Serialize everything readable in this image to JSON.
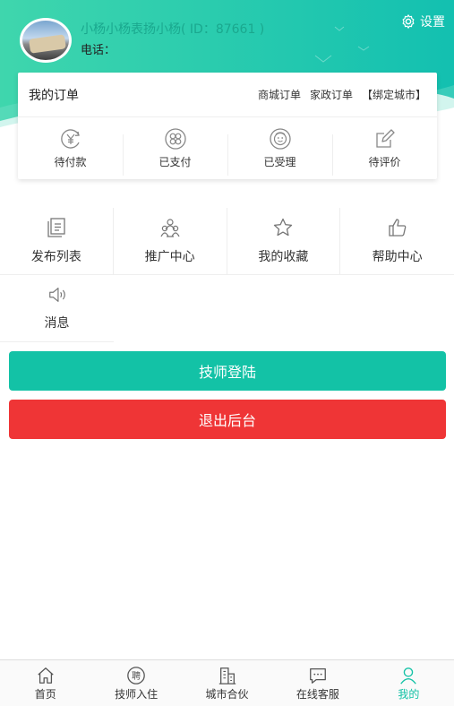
{
  "header": {
    "user_name": "小杨小杨表扬小杨( ID：87661 )",
    "phone_label": "电话：",
    "settings_label": "设置"
  },
  "orders": {
    "title": "我的订单",
    "links": [
      "商城订单",
      "家政订单",
      "【绑定城市】"
    ],
    "states": [
      {
        "label": "待付款",
        "icon": "yuan-refresh-icon"
      },
      {
        "label": "已支付",
        "icon": "paid-icon"
      },
      {
        "label": "已受理",
        "icon": "accepted-icon"
      },
      {
        "label": "待评价",
        "icon": "edit-review-icon"
      }
    ]
  },
  "grid": {
    "items": [
      {
        "label": "发布列表",
        "icon": "list-icon"
      },
      {
        "label": "推广中心",
        "icon": "people-icon"
      },
      {
        "label": "我的收藏",
        "icon": "star-icon"
      },
      {
        "label": "帮助中心",
        "icon": "thumbs-up-icon"
      },
      {
        "label": "消息",
        "icon": "speaker-icon"
      }
    ]
  },
  "buttons": {
    "technician_login": "技师登陆",
    "logout": "退出后台"
  },
  "tabbar": {
    "tabs": [
      {
        "label": "首页",
        "icon": "home-icon"
      },
      {
        "label": "技师入住",
        "icon": "hire-icon"
      },
      {
        "label": "城市合伙",
        "icon": "building-icon"
      },
      {
        "label": "在线客服",
        "icon": "chat-icon"
      },
      {
        "label": "我的",
        "icon": "user-icon",
        "active": true
      }
    ]
  },
  "colors": {
    "primary": "#13c2a6",
    "danger": "#ef3536",
    "header_gradient_start": "#3fd6ad",
    "header_gradient_end": "#13c0b0"
  }
}
